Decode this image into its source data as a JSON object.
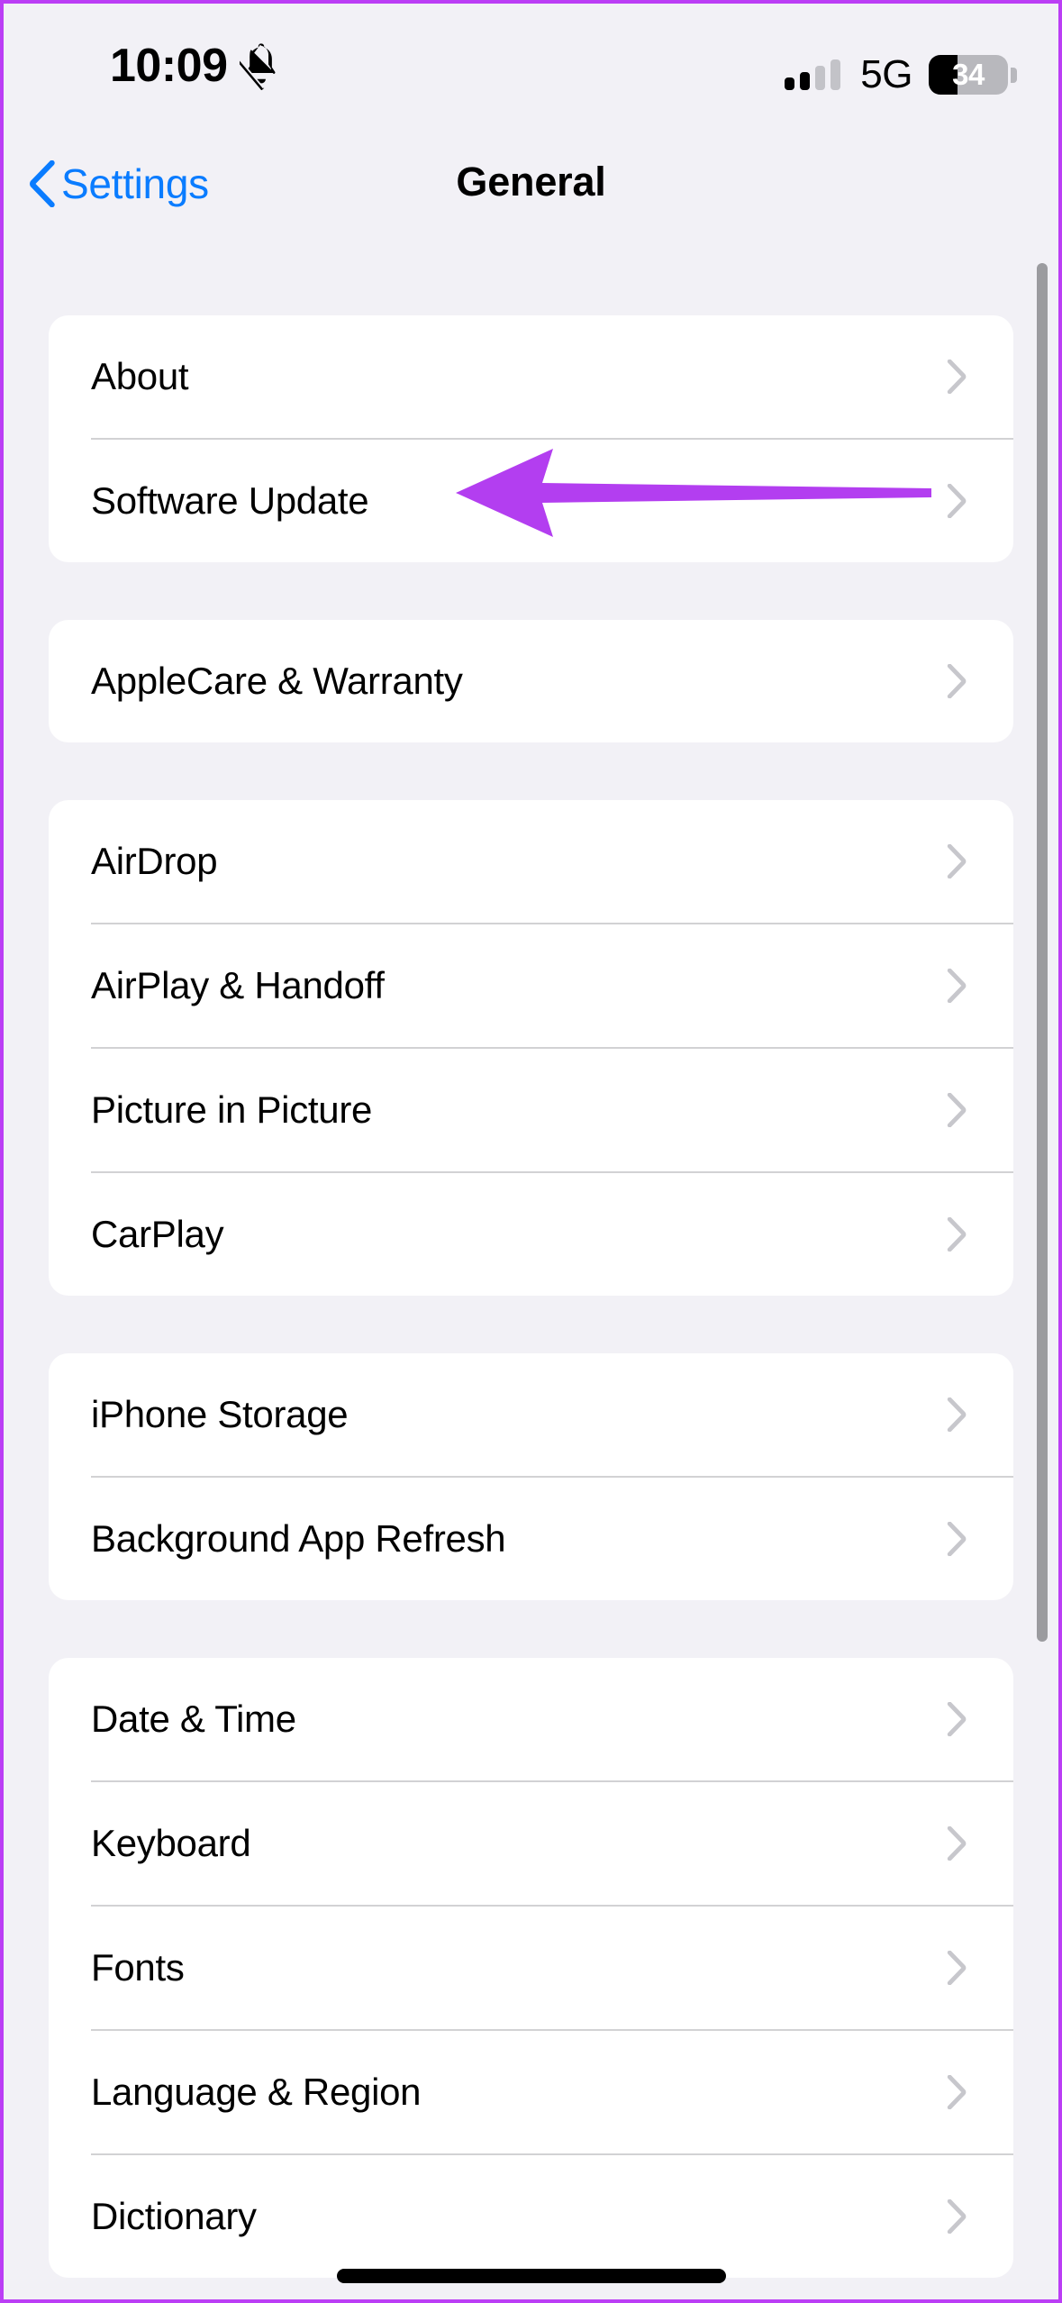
{
  "status_bar": {
    "time": "10:09",
    "silent_mode_icon": "bell-slash-icon",
    "signal_icon": "cellular-signal-icon",
    "signal_bars_active": 2,
    "signal_bars_total": 4,
    "network": "5G",
    "battery_percent": "34",
    "battery_level": 34
  },
  "nav": {
    "back_label": "Settings",
    "back_icon": "chevron-left-icon",
    "title": "General"
  },
  "sections": [
    {
      "id": "section-about",
      "rows": [
        {
          "label": "About",
          "name": "row-about"
        },
        {
          "label": "Software Update",
          "name": "row-software-update"
        }
      ]
    },
    {
      "id": "section-applecare",
      "rows": [
        {
          "label": "AppleCare & Warranty",
          "name": "row-applecare-warranty"
        }
      ]
    },
    {
      "id": "section-connectivity",
      "rows": [
        {
          "label": "AirDrop",
          "name": "row-airdrop"
        },
        {
          "label": "AirPlay & Handoff",
          "name": "row-airplay-handoff"
        },
        {
          "label": "Picture in Picture",
          "name": "row-picture-in-picture"
        },
        {
          "label": "CarPlay",
          "name": "row-carplay"
        }
      ]
    },
    {
      "id": "section-storage",
      "rows": [
        {
          "label": "iPhone Storage",
          "name": "row-iphone-storage"
        },
        {
          "label": "Background App Refresh",
          "name": "row-background-app-refresh"
        }
      ]
    },
    {
      "id": "section-locale",
      "rows": [
        {
          "label": "Date & Time",
          "name": "row-date-time"
        },
        {
          "label": "Keyboard",
          "name": "row-keyboard"
        },
        {
          "label": "Fonts",
          "name": "row-fonts"
        },
        {
          "label": "Language & Region",
          "name": "row-language-region"
        },
        {
          "label": "Dictionary",
          "name": "row-dictionary"
        }
      ]
    }
  ],
  "annotation": {
    "type": "arrow",
    "points_to": "Software Update",
    "direction": "left",
    "color": "#b33ef0"
  },
  "colors": {
    "background": "#f2f1f6",
    "card": "#ffffff",
    "accent_blue": "#0a7cff",
    "chevron_gray": "#c7c7cc",
    "divider": "#d2d2d4",
    "annotation_purple": "#b33ef0",
    "border_purple": "#bb3ef5",
    "scrollbar": "#9b9b9f"
  }
}
